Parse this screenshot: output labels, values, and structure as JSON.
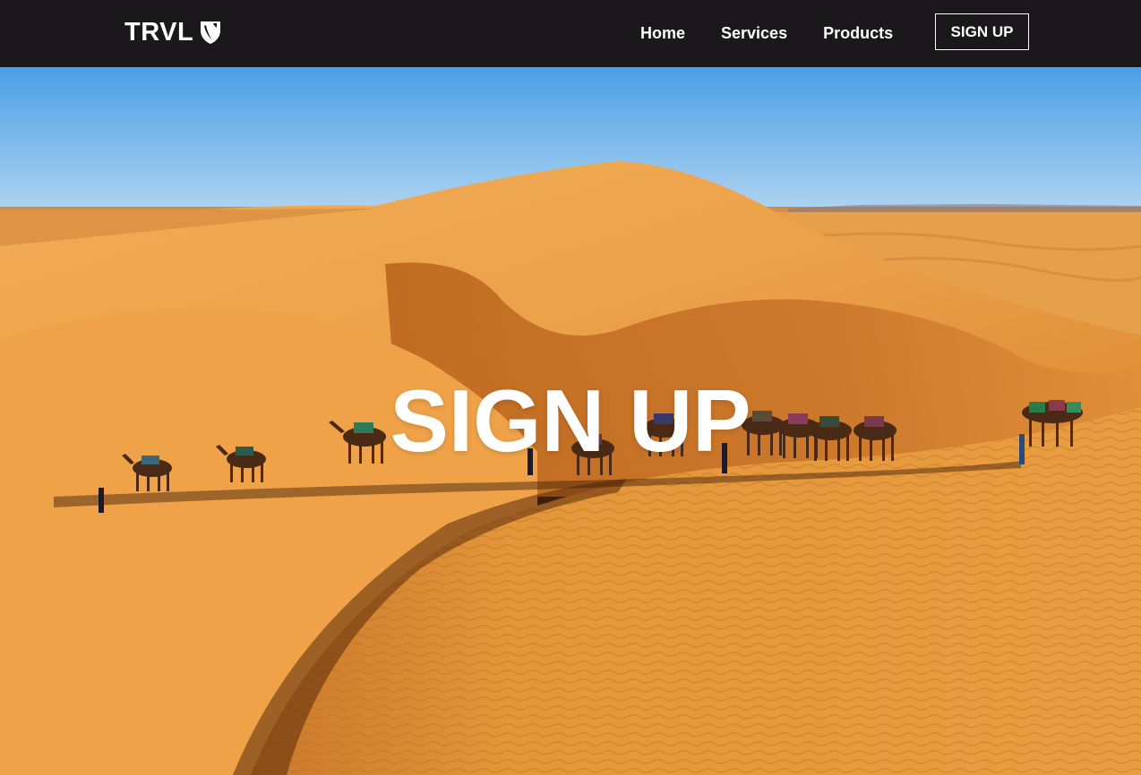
{
  "nav": {
    "logo_text": "TRVL",
    "logo_icon": "typo3-shield-icon",
    "links": [
      {
        "label": "Home"
      },
      {
        "label": "Services"
      },
      {
        "label": "Products"
      }
    ],
    "signup_label": "SIGN UP"
  },
  "hero": {
    "title": "SIGN UP",
    "image": "desert-dunes-camel-caravan"
  },
  "colors": {
    "navbar_bg": "#1a181a",
    "text": "#ffffff",
    "sky_top": "#4a9fe6",
    "sky_bottom": "#a9d1f2",
    "sand_light": "#f0a640",
    "sand_dark": "#b8621a"
  }
}
